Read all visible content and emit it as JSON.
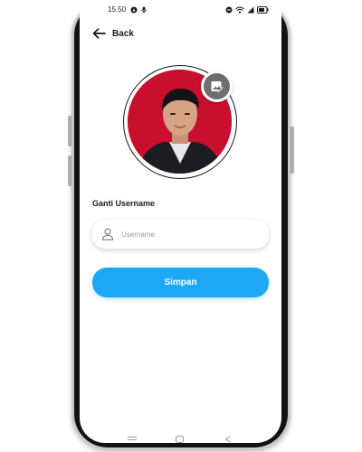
{
  "status_bar": {
    "time": "15.50"
  },
  "header": {
    "back_label": "Back"
  },
  "profile": {
    "edit_photo_icon": "edit-image-icon"
  },
  "form": {
    "section_label": "Ganti Username",
    "username_placeholder": "Username",
    "username_value": "",
    "save_label": "Simpan"
  },
  "colors": {
    "accent": "#1ea7f5",
    "avatar_bg": "#c8102e",
    "edit_icon_bg": "#6d6d6d"
  }
}
